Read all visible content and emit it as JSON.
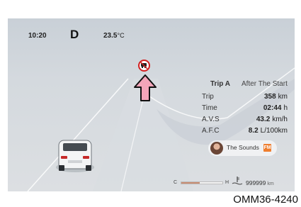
{
  "status": {
    "time": "10:20",
    "gear": "D",
    "temperature": "23.5",
    "temperature_unit": "°C"
  },
  "trip": {
    "title": "Trip A",
    "subtitle": "After The Start",
    "rows": [
      {
        "label": "Trip",
        "value": "358",
        "unit": "km"
      },
      {
        "label": "Time",
        "value": "02:44",
        "unit": "h"
      },
      {
        "label": "A.V.S",
        "value": "43.2",
        "unit": "km/h"
      },
      {
        "label": "A.F.C",
        "value": "8.2",
        "unit": "L/100km"
      }
    ]
  },
  "media": {
    "label": "The Sounds",
    "badge": "FM"
  },
  "gauge": {
    "fuel_low": "C",
    "fuel_high": "H",
    "fuel_fraction": 0.45,
    "odometer": "999999",
    "odometer_unit": "km"
  },
  "icons": {
    "warning": "no-overtaking-sign-icon",
    "direction": "arrow-up-icon",
    "car": "car-icon",
    "coolant": "coolant-temp-icon"
  },
  "colors": {
    "warning_red": "#d32020",
    "arrow_pink": "#f4a5b9",
    "fuel_fill": "#c88e73",
    "badge_orange": "#ef7e2f"
  },
  "figure_code": "OMM36-4240"
}
